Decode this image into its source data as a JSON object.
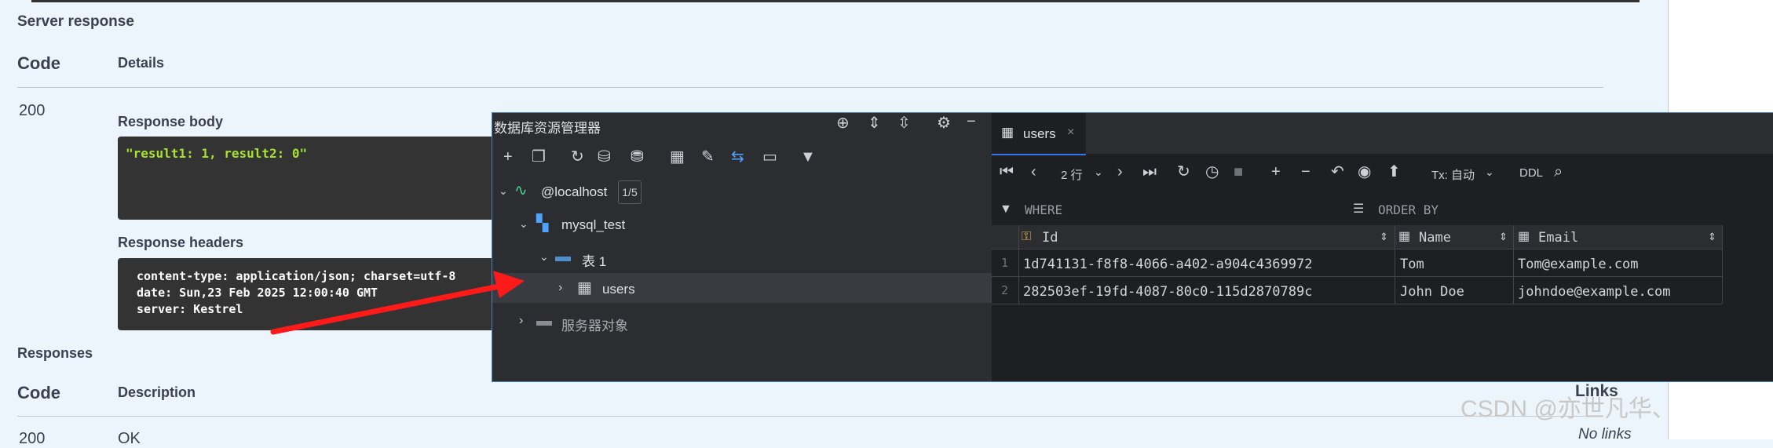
{
  "swagger": {
    "server_response": "Server response",
    "code_header": "Code",
    "details_header": "Details",
    "status_code": "200",
    "response_body_label": "Response body",
    "response_body": "\"result1: 1, result2: 0\"",
    "response_headers_label": "Response headers",
    "headers": [
      "content-type: application/json; charset=utf-8",
      "date: Sun,23 Feb 2025 12:00:40 GMT",
      "server: Kestrel"
    ],
    "responses_label": "Responses",
    "code_header2": "Code",
    "description_header": "Description",
    "links_header": "Links",
    "row_code": "200",
    "row_desc": "OK",
    "row_links": "No links"
  },
  "db_explorer": {
    "title": "数据库资源管理器",
    "host": "@localhost",
    "host_badge": "1/5",
    "schema": "mysql_test",
    "tables_folder": "表 1",
    "table": "users",
    "server_objects": "服务器对象"
  },
  "editor": {
    "tab_label": "users",
    "rows_label": "2 行",
    "tx_label": "Tx: 自动",
    "ddl_label": "DDL",
    "where_label": "WHERE",
    "orderby_label": "ORDER BY",
    "columns": [
      "Id",
      "Name",
      "Email"
    ],
    "rows": [
      {
        "num": "1",
        "id": "1d741131-f8f8-4066-a402-a904c4369972",
        "name": "Tom",
        "email": "Tom@example.com"
      },
      {
        "num": "2",
        "id": "282503ef-19fd-4087-80c0-115d2870789c",
        "name": "John Doe",
        "email": "johndoe@example.com"
      }
    ]
  },
  "watermark": "CSDN @亦世凡华、",
  "colors": {
    "accent": "#3574f0",
    "arrow": "#ff1a1a",
    "code_green": "#a6e22e"
  }
}
